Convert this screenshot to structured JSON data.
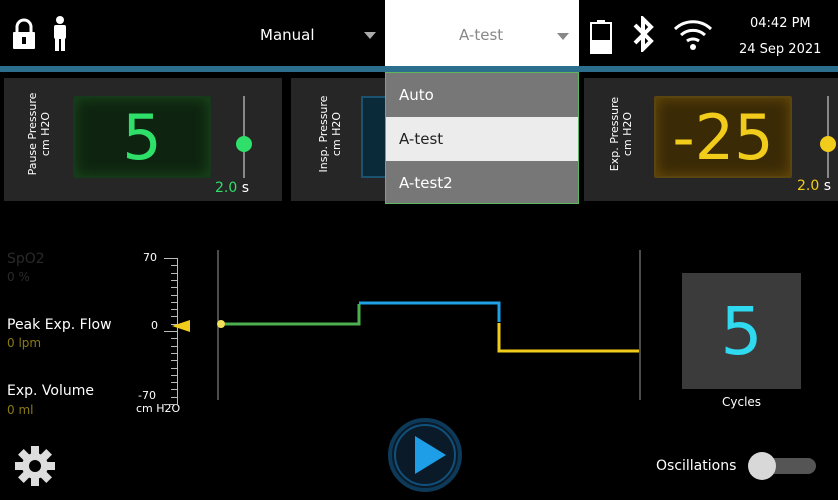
{
  "status_bar": {
    "mode": "Manual",
    "profile": "A-test",
    "time": "04:42 PM",
    "date": "24 Sep 2021",
    "icons": [
      "lock-icon",
      "person-icon",
      "battery-icon",
      "bluetooth-icon",
      "wifi-icon"
    ]
  },
  "dropdown": {
    "options": [
      "Auto",
      "A-test",
      "A-test2"
    ],
    "selected": "A-test"
  },
  "panels": {
    "pause": {
      "label": "Pause Pressure",
      "unit": "cm H2O",
      "value": "5",
      "time": "2.0",
      "time_unit": "s",
      "color": "#2ee06a"
    },
    "insp": {
      "label": "Insp. Pressure",
      "unit": "cm H2O"
    },
    "exp": {
      "label": "Exp. Pressure",
      "unit": "cm H2O",
      "value": "-25",
      "time": "2.0",
      "time_unit": "s",
      "color": "#f2cc1a"
    }
  },
  "readouts": {
    "spo2": {
      "label": "SpO2",
      "value": "0 %"
    },
    "peak_exp_flow": {
      "label": "Peak Exp. Flow",
      "value": "0 lpm"
    },
    "exp_volume": {
      "label": "Exp. Volume",
      "value": "0 ml"
    }
  },
  "scale": {
    "max": "70",
    "zero": "0",
    "min": "-70",
    "unit": "cm H2O"
  },
  "waveform": {
    "colors": {
      "pause": "#4caf50",
      "insp": "#1fa0e6",
      "exp": "#f2cc1a"
    }
  },
  "cycles": {
    "value": "5",
    "label": "Cycles"
  },
  "controls": {
    "oscillations_label": "Oscillations",
    "oscillations_on": false,
    "settings_icon": "gear-icon",
    "play_icon": "play-icon"
  }
}
